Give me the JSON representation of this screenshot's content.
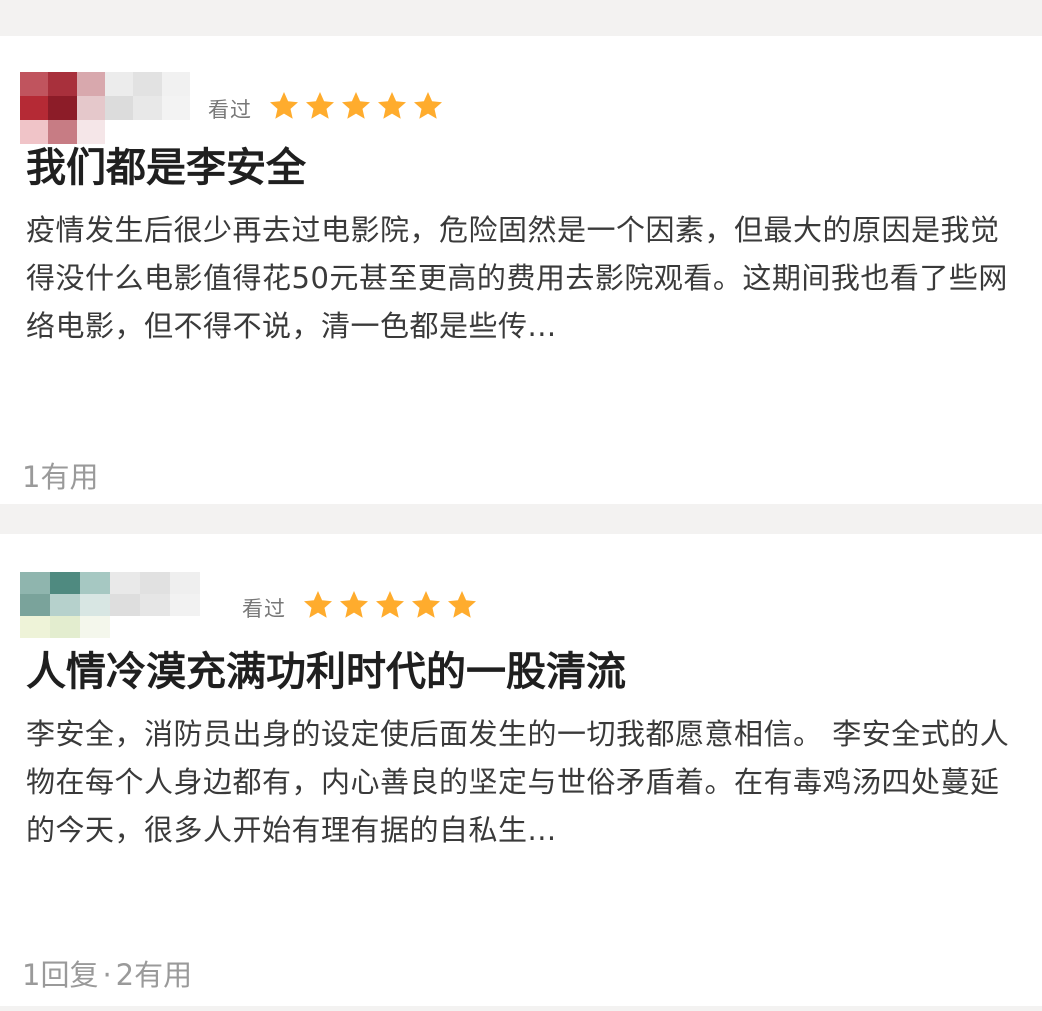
{
  "reviews": [
    {
      "status": "看过",
      "rating": 5,
      "title": "我们都是李安全",
      "body": "疫情发生后很少再去过电影院，危险固然是一个因素，但最大的原因是我觉得没什么电影值得花50元甚至更高的费用去影院观看。这期间我也看了些网络电影，但不得不说，清一色都是些传...",
      "useful": "1有用",
      "avatar_colors": [
        "#c0545e",
        "#a8303c",
        "#d8a8ad",
        "#ececec",
        "#e2e2e2",
        "#f1f1f1",
        "#b52a35",
        "#8c1c28",
        "#e5c8cb",
        "#dcdcdc",
        "#e8e8e8",
        "#f3f3f3",
        "#f0c4c8",
        "#c77c84",
        "#f5e6e8",
        "#ffffff",
        "#ffffff",
        "#ffffff"
      ]
    },
    {
      "status": "看过",
      "rating": 5,
      "title": "人情冷漠充满功利时代的一股清流",
      "body": "李安全，消防员出身的设定使后面发生的一切我都愿意相信。 李安全式的人物在每个人身边都有，内心善良的坚定与世俗矛盾着。在有毒鸡汤四处蔓延的今天，很多人开始有理有据的自私生...",
      "replies": "1回复",
      "separator": "·",
      "useful": "2有用",
      "avatar_colors": [
        "#8fb5ae",
        "#4f8a80",
        "#a6c8c2",
        "#e9e9e9",
        "#e1e1e1",
        "#efefef",
        "#7aa39b",
        "#b6d1cc",
        "#d8e6e3",
        "#dedede",
        "#e6e6e6",
        "#f2f2f2",
        "#eef3d8",
        "#e3edcf",
        "#f4f7ec",
        "#ffffff",
        "#ffffff",
        "#ffffff"
      ]
    }
  ]
}
